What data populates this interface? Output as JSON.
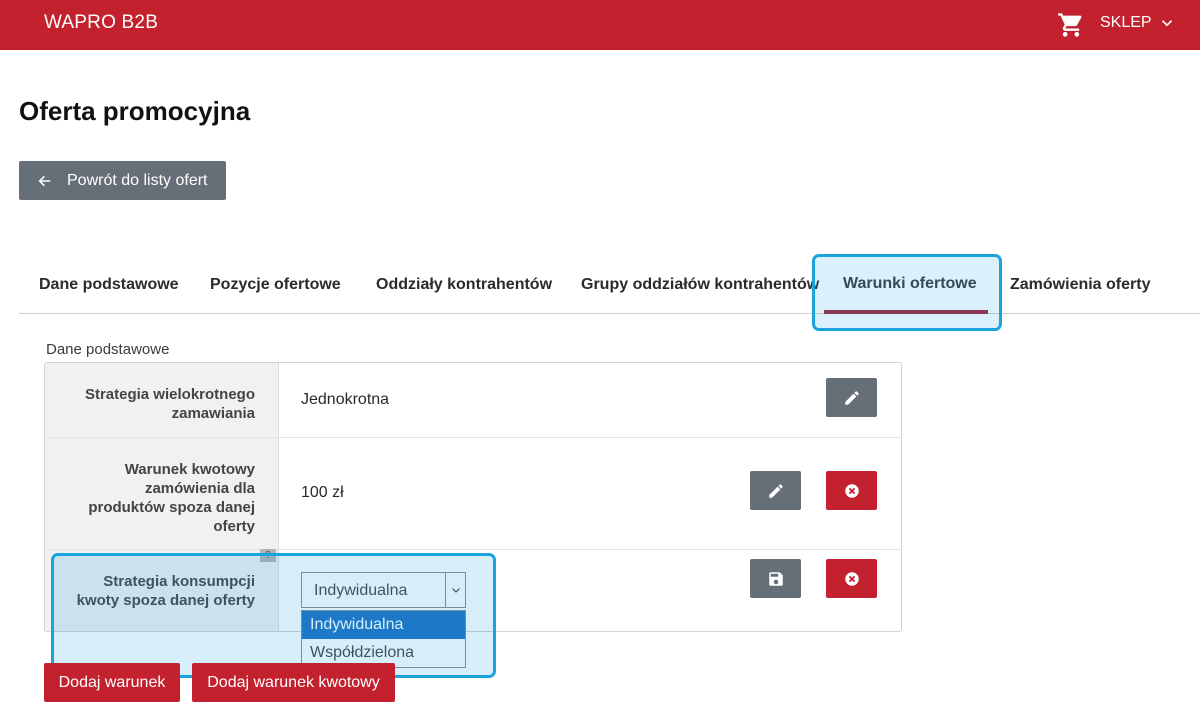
{
  "header": {
    "brand": "WAPRO B2B",
    "shop_label": "SKLEP",
    "icons": {
      "cart": "cart-icon",
      "chevron": "chevron-down-icon"
    }
  },
  "page": {
    "title": "Oferta promocyjna",
    "back_button": "Powrót do listy ofert"
  },
  "tabs": [
    {
      "label": "Dane podstawowe",
      "active": false
    },
    {
      "label": "Pozycje ofertowe",
      "active": false
    },
    {
      "label": "Oddziały kontrahentów",
      "active": false
    },
    {
      "label": "Grupy oddziałów kontrahentów",
      "active": false
    },
    {
      "label": "Warunki ofertowe",
      "active": true
    },
    {
      "label": "Zamówienia oferty",
      "active": false
    }
  ],
  "section": {
    "title": "Dane podstawowe",
    "rows": [
      {
        "label": "Strategia wielokrotnego zamawiania",
        "value": "Jednokrotna"
      },
      {
        "label": "Warunek kwotowy zamówienia dla produktów spoza danej oferty",
        "value": "100 zł"
      },
      {
        "label": "Strategia konsumpcji kwoty spoza danej oferty",
        "help": "?"
      }
    ],
    "select": {
      "value": "Indywidualna",
      "options": [
        "Indywidualna",
        "Współdzielona"
      ],
      "selected_index": 0
    }
  },
  "actions": {
    "add_condition": "Dodaj warunek",
    "add_amount_condition": "Dodaj warunek kwotowy"
  },
  "colors": {
    "brand_red": "#c3212e",
    "button_gray": "#666e77",
    "highlight_blue": "#1aa3de",
    "option_selected": "#1e71c2",
    "tab_underline": "#a1253a"
  }
}
